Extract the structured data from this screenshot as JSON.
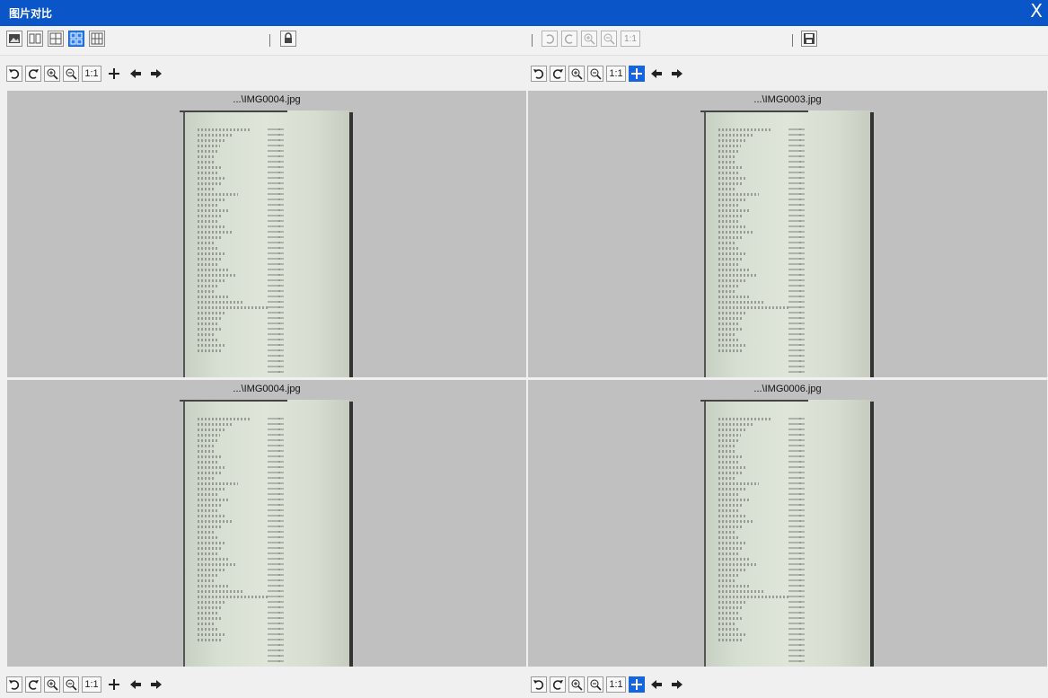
{
  "window": {
    "title": "图片对比",
    "close_label": "X"
  },
  "toolbar": {
    "layout_buttons": [
      {
        "name": "single-view",
        "active": false
      },
      {
        "name": "two-view",
        "active": false
      },
      {
        "name": "three-view",
        "active": false
      },
      {
        "name": "four-view",
        "active": true
      },
      {
        "name": "six-view",
        "active": false
      }
    ],
    "lock_label": "lock",
    "zoom_one_label": "1:1",
    "save_label": "save"
  },
  "panel_controls": {
    "one_to_one": "1:1"
  },
  "panels": [
    {
      "filename": "...\\IMG0004.jpg"
    },
    {
      "filename": "...\\IMG0003.jpg"
    },
    {
      "filename": "...\\IMG0004.jpg"
    },
    {
      "filename": "...\\IMG0006.jpg"
    }
  ],
  "colors": {
    "titlebar": "#0a56c9",
    "active": "#2d7ff0",
    "panel_bg": "#c0c0c0"
  }
}
